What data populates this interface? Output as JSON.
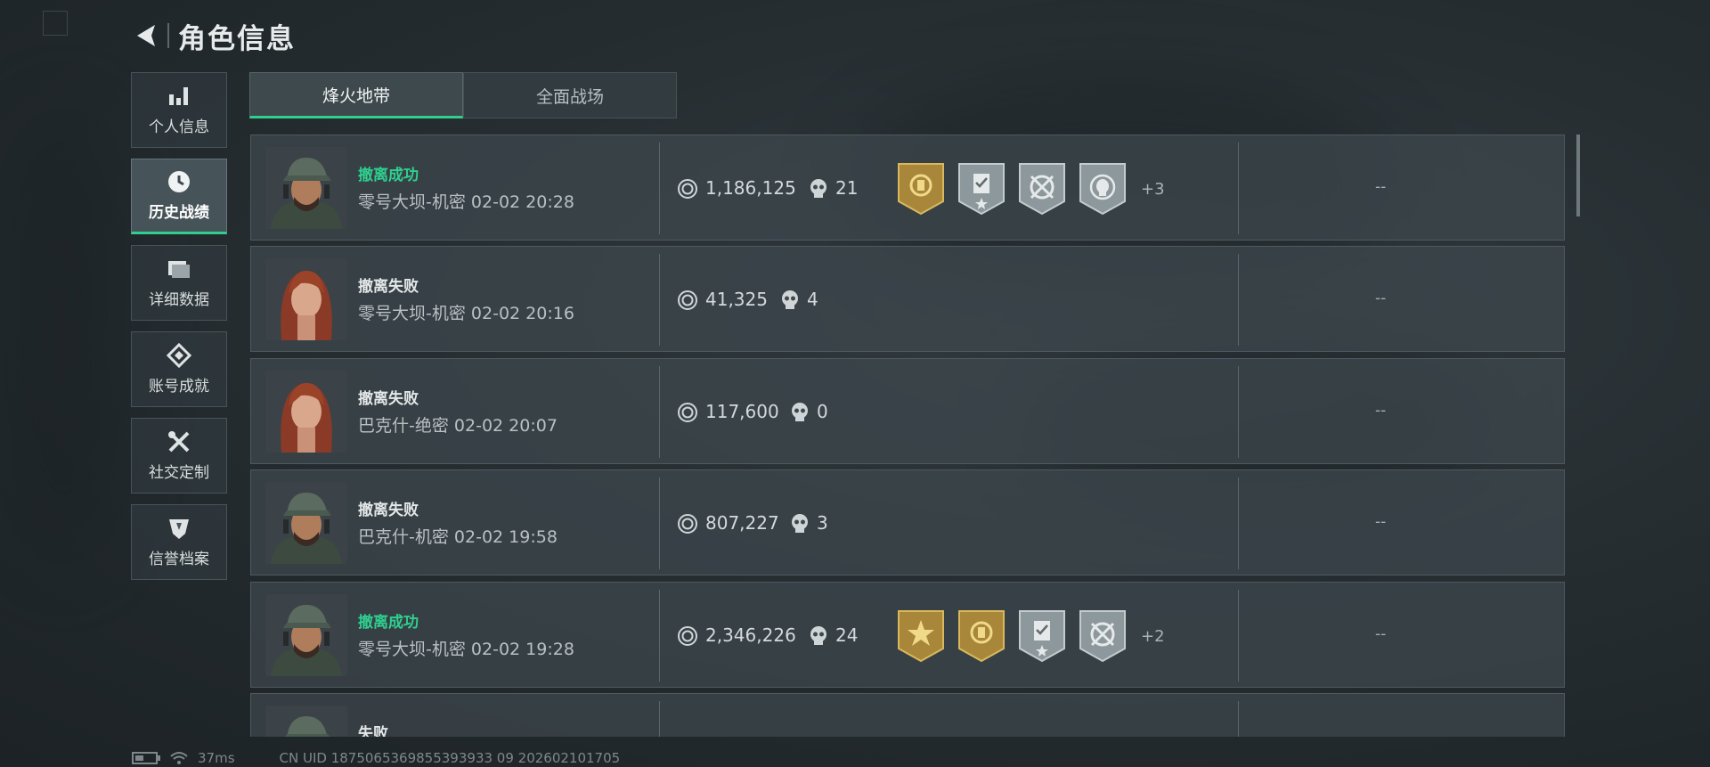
{
  "header": {
    "title": "角色信息"
  },
  "sidebar": {
    "items": [
      {
        "label": "个人信息",
        "icon": "bar-chart-icon"
      },
      {
        "label": "历史战绩",
        "icon": "clock-icon",
        "active": true
      },
      {
        "label": "详细数据",
        "icon": "folder-icon"
      },
      {
        "label": "账号成就",
        "icon": "achievement-icon"
      },
      {
        "label": "社交定制",
        "icon": "tools-icon"
      },
      {
        "label": "信誉档案",
        "icon": "shield-icon"
      }
    ]
  },
  "tabs": [
    {
      "label": "烽火地带",
      "active": true
    },
    {
      "label": "全面战场",
      "active": false
    }
  ],
  "records": [
    {
      "status": "撤离成功",
      "status_color": "#2fd08f",
      "map": "零号大坝-机密",
      "time": "02-02 20:28",
      "money": "1,186,125",
      "kills": "21",
      "avatar": "male-operator",
      "badges": [
        "gold",
        "silver-clipboard",
        "silver-crosshair",
        "silver-skull"
      ],
      "more": "+3",
      "extra": "--"
    },
    {
      "status": "撤离失败",
      "status_color": "#e3e7e8",
      "map": "零号大坝-机密",
      "time": "02-02 20:16",
      "money": "41,325",
      "kills": "4",
      "avatar": "female-operator",
      "badges": [],
      "more": "",
      "extra": "--"
    },
    {
      "status": "撤离失败",
      "status_color": "#e3e7e8",
      "map": "巴克什-绝密",
      "time": "02-02 20:07",
      "money": "117,600",
      "kills": "0",
      "avatar": "female-operator",
      "badges": [],
      "more": "",
      "extra": "--"
    },
    {
      "status": "撤离失败",
      "status_color": "#e3e7e8",
      "map": "巴克什-机密",
      "time": "02-02 19:58",
      "money": "807,227",
      "kills": "3",
      "avatar": "male-operator",
      "badges": [],
      "more": "",
      "extra": "--"
    },
    {
      "status": "撤离成功",
      "status_color": "#2fd08f",
      "map": "零号大坝-机密",
      "time": "02-02 19:28",
      "money": "2,346,226",
      "kills": "24",
      "avatar": "male-operator",
      "badges": [
        "gold-star",
        "gold",
        "silver-clipboard",
        "silver-crosshair"
      ],
      "more": "+2",
      "extra": "--"
    },
    {
      "status": "失败",
      "status_color": "#e3e7e8",
      "map": "",
      "time": "",
      "money": "",
      "kills": "",
      "avatar": "male-operator",
      "badges": [],
      "more": "",
      "extra": ""
    }
  ],
  "footer": {
    "latency": "37ms",
    "uid": "CN UID 1875065369855393933 09 202602101705"
  },
  "colors": {
    "accent": "#2fd08f",
    "gold_badge": "#b8953a",
    "silver_badge": "#8d989c"
  }
}
